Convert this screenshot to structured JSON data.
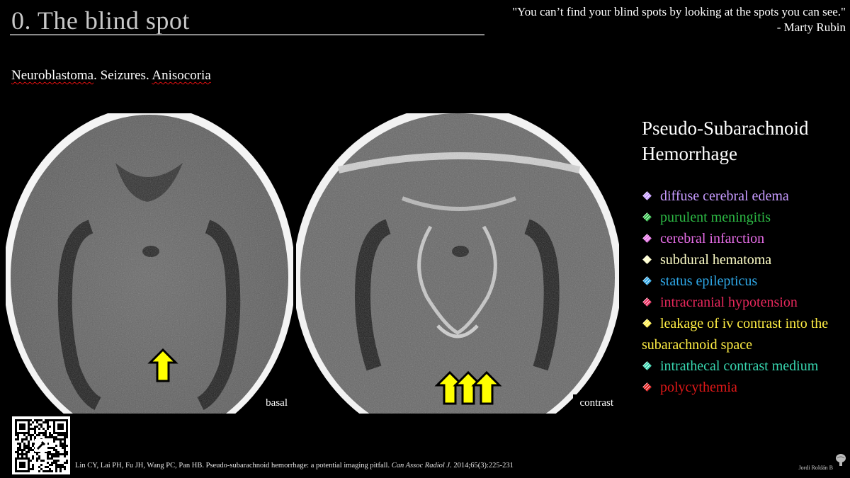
{
  "header": {
    "title": "0. The blind spot",
    "quote_line1": "\"You can’t find your blind spots by looking at the spots you can see.\"",
    "quote_line2": "- Marty Rubin"
  },
  "case": {
    "parts": [
      "Neuroblastoma",
      ". Seizures. ",
      "Anisocoria"
    ]
  },
  "images": {
    "basal_label": "basal",
    "contrast_label": "contrast",
    "arrow_color": "#ffff00"
  },
  "ddx": {
    "title_line1": "Pseudo-Subarachnoid",
    "title_line2": "Hemorrhage",
    "items": [
      {
        "text": "diffuse cerebral edema",
        "color": "#c79bff"
      },
      {
        "text": "purulent meningitis",
        "color": "#2dbb45"
      },
      {
        "text": "cerebral infarction",
        "color": "#e66ce6"
      },
      {
        "text": "subdural hematoma",
        "color": "#ffffc8"
      },
      {
        "text": "status epilepticus",
        "color": "#2ea8e8"
      },
      {
        "text": "intracranial hypotension",
        "color": "#e8285c"
      },
      {
        "text": "leakage of iv contrast into the subarachnoid space",
        "color": "#ffee44"
      },
      {
        "text": "intrathecal contrast medium",
        "color": "#38d6b0"
      },
      {
        "text": "polycythemia",
        "color": "#e01818"
      }
    ]
  },
  "footer": {
    "citation_authors": "Lin CY, Lai PH, Fu JH, Wang PC, Pan HB. Pseudo-subarachnoid  hemorrhage: a potential imaging pitfall. ",
    "citation_journal": "Can Assoc Radiol J",
    "citation_tail": ". 2014;65(3):225-231",
    "author": "Jordi Roldán B"
  }
}
